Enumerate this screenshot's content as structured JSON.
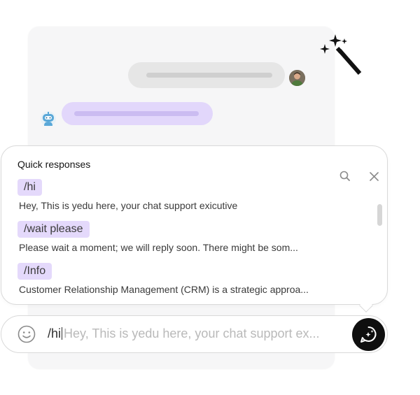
{
  "quick_responses": {
    "title": "Quick responses",
    "items": [
      {
        "tag": "/hi",
        "description": "Hey, This is yedu here, your chat support exicutive"
      },
      {
        "tag": "/wait please",
        "description": "Please wait a moment; we will reply soon. There might be som..."
      },
      {
        "tag": "/Info",
        "description": "Customer Relationship Management (CRM) is a strategic approa..."
      }
    ]
  },
  "composer": {
    "typed": "/hi",
    "suggestion": "Hey, This is yedu here, your chat support ex..."
  },
  "icons": {
    "search": "search-icon",
    "close": "close-icon",
    "emoji": "smiley-icon",
    "send": "chat-magic-icon",
    "wand": "magic-wand-icon",
    "user_avatar": "user-avatar",
    "bot_avatar": "bot-avatar"
  },
  "colors": {
    "accent_lavender": "#e4d9fb",
    "send_button": "#0f0f0f",
    "card_background": "#f6f6f7"
  }
}
